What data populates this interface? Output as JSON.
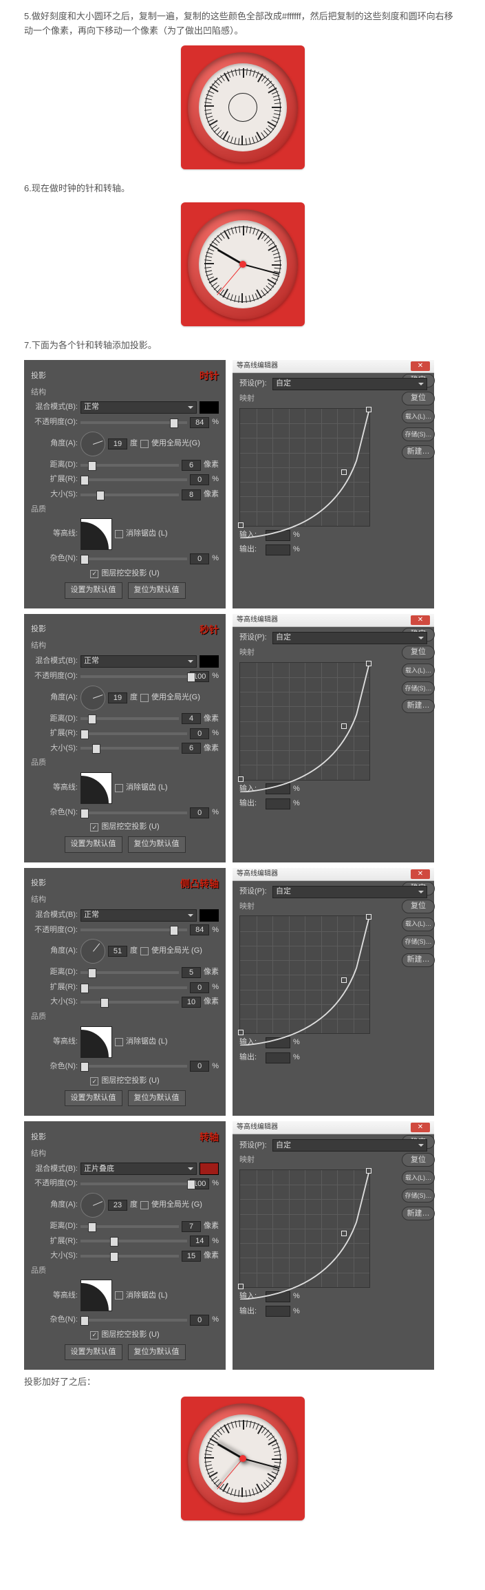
{
  "steps": {
    "s5": "5.做好刻度和大小圆环之后，复制一遍，复制的这些颜色全部改成#ffffff，然后把复制的这些刻度和圆环向右移动一个像素，再向下移动一个像素（为了做出凹陷感）。",
    "s6": "6.现在做时钟的针和转轴。",
    "s7": "7.下面为各个针和转轴添加投影。",
    "after": "投影加好了之后："
  },
  "shadow_panels": [
    {
      "title_group": "投影",
      "structure_label": "结构",
      "red_label": "时针",
      "swatch_color": "#000000",
      "blend_label": "混合模式(B):",
      "blend_value": "正常",
      "opacity_label": "不透明度(O):",
      "opacity": "84",
      "opacity_unit": "%",
      "angle_label": "角度(A):",
      "angle": "19",
      "angle_unit": "度",
      "global_light": "使用全局光(G)",
      "distance_label": "距离(D):",
      "distance": "6",
      "distance_unit": "像素",
      "spread_label": "扩展(R):",
      "spread": "0",
      "spread_unit": "%",
      "size_label": "大小(S):",
      "size": "8",
      "size_unit": "像素",
      "quality_label": "品质",
      "contour_label": "等高线:",
      "anti_label": "消除锯齿 (L)",
      "noise_label": "杂色(N):",
      "noise": "0",
      "noise_unit": "%",
      "knockout": "图层挖空投影 (U)",
      "make_default": "设置为默认值",
      "reset_default": "复位为默认值"
    },
    {
      "title_group": "投影",
      "structure_label": "结构",
      "red_label": "秒针",
      "swatch_color": "#000000",
      "blend_label": "混合模式(B):",
      "blend_value": "正常",
      "opacity_label": "不透明度(O):",
      "opacity": "100",
      "opacity_unit": "%",
      "angle_label": "角度(A):",
      "angle": "19",
      "angle_unit": "度",
      "global_light": "使用全局光(G)",
      "distance_label": "距离(D):",
      "distance": "4",
      "distance_unit": "像素",
      "spread_label": "扩展(R):",
      "spread": "0",
      "spread_unit": "%",
      "size_label": "大小(S):",
      "size": "6",
      "size_unit": "像素",
      "quality_label": "品质",
      "contour_label": "等高线:",
      "anti_label": "消除锯齿 (L)",
      "noise_label": "杂色(N):",
      "noise": "0",
      "noise_unit": "%",
      "knockout": "图层挖空投影 (U)",
      "make_default": "设置为默认值",
      "reset_default": "复位为默认值"
    },
    {
      "title_group": "投影",
      "structure_label": "结构",
      "red_label": "侧凸转轴",
      "swatch_color": "#000000",
      "blend_label": "混合模式(B):",
      "blend_value": "正常",
      "opacity_label": "不透明度(O):",
      "opacity": "84",
      "opacity_unit": "%",
      "angle_label": "角度(A):",
      "angle": "51",
      "angle_unit": "度",
      "global_light": "使用全局光 (G)",
      "distance_label": "距离(D):",
      "distance": "5",
      "distance_unit": "像素",
      "spread_label": "扩展(R):",
      "spread": "0",
      "spread_unit": "%",
      "size_label": "大小(S):",
      "size": "10",
      "size_unit": "像素",
      "quality_label": "品质",
      "contour_label": "等高线:",
      "anti_label": "消除锯齿 (L)",
      "noise_label": "杂色(N):",
      "noise": "0",
      "noise_unit": "%",
      "knockout": "图层挖空投影 (U)",
      "make_default": "设置为默认值",
      "reset_default": "复位为默认值"
    },
    {
      "title_group": "投影",
      "structure_label": "结构",
      "red_label": "转轴",
      "swatch_color": "#9f1c17",
      "blend_label": "混合模式(B):",
      "blend_value": "正片叠底",
      "opacity_label": "不透明度(O):",
      "opacity": "100",
      "opacity_unit": "%",
      "angle_label": "角度(A):",
      "angle": "23",
      "angle_unit": "度",
      "global_light": "使用全局光 (G)",
      "distance_label": "距离(D):",
      "distance": "7",
      "distance_unit": "像素",
      "spread_label": "扩展(R):",
      "spread": "14",
      "spread_unit": "%",
      "size_label": "大小(S):",
      "size": "15",
      "size_unit": "像素",
      "quality_label": "品质",
      "contour_label": "等高线:",
      "anti_label": "消除锯齿 (L)",
      "noise_label": "杂色(N):",
      "noise": "0",
      "noise_unit": "%",
      "knockout": "图层挖空投影 (U)",
      "make_default": "设置为默认值",
      "reset_default": "复位为默认值"
    }
  ],
  "contour_editor": {
    "title": "等高线编辑器",
    "preset_label": "预设(P):",
    "preset_value": "自定",
    "mapping_label": "映射",
    "ok": "确定",
    "reset": "复位",
    "load": "载入(L)…",
    "save": "存储(S)…",
    "new": "新建…",
    "input_label": "输入:",
    "input_unit": "%",
    "output_label": "输出:",
    "output_unit": "%"
  }
}
